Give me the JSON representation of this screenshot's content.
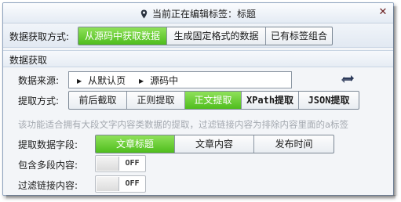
{
  "window": {
    "title": "当前正在编辑标签：标题",
    "pin_icon": "pin-icon",
    "close_icon": "close-icon"
  },
  "fetch_mode": {
    "label": "数据获取方式:",
    "options": [
      "从源码中获取数据",
      "生成固定格式的数据",
      "已有标签组合"
    ],
    "selected": "从源码中获取数据"
  },
  "section": {
    "title": "数据获取"
  },
  "data_source": {
    "label": "数据来源:",
    "path": [
      "从默认页",
      "源码中"
    ],
    "refresh_icon": "refresh-icon"
  },
  "extract_method": {
    "label": "提取方式:",
    "options": [
      "前后截取",
      "正则提取",
      "正文提取",
      "XPath提取",
      "JSON提取"
    ],
    "selected": "正文提取"
  },
  "hint": "该功能适合拥有大段文字内容类数据的提取，过滤链接内容为排除内容里面的a标签",
  "extract_field": {
    "label": "提取数据字段:",
    "options": [
      "文章标题",
      "文章内容",
      "发布时间"
    ],
    "selected": "文章标题"
  },
  "multi_paragraph": {
    "label": "包含多段内容:",
    "state": "OFF"
  },
  "filter_links": {
    "label": "过滤链接内容:",
    "state": "OFF"
  },
  "colors": {
    "active": "#5cc82a",
    "border": "#8da2bd",
    "hint_text": "#a4a9b0"
  }
}
